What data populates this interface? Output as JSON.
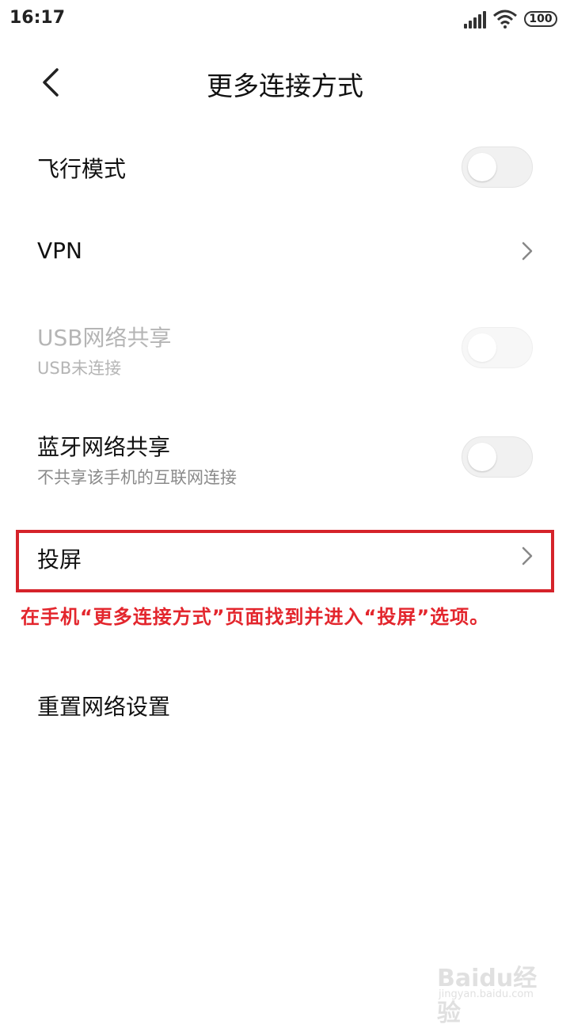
{
  "status_bar": {
    "time": "16:17",
    "battery": "100"
  },
  "header": {
    "title": "更多连接方式"
  },
  "items": [
    {
      "label": "飞行模式",
      "control": "toggle",
      "state": "off",
      "enabled": true
    },
    {
      "label": "VPN",
      "control": "chevron"
    },
    {
      "label": "USB网络共享",
      "sublabel": "USB未连接",
      "control": "toggle",
      "state": "off",
      "enabled": false
    },
    {
      "label": "蓝牙网络共享",
      "sublabel": "不共享该手机的互联网连接",
      "control": "toggle",
      "state": "off",
      "enabled": true
    },
    {
      "label": "投屏",
      "control": "chevron"
    },
    {
      "label": "重置网络设置"
    }
  ],
  "annotation": {
    "text": "在手机“更多连接方式”页面找到并进入“投屏”选项。",
    "color": "#e3262d"
  },
  "watermark": {
    "main": "Baidu经验",
    "sub": "jingyan.baidu.com"
  },
  "icons": {
    "back": "back-arrow-icon",
    "chevron": "chevron-right-icon",
    "signal": "signal-icon",
    "wifi": "wifi-icon",
    "battery": "battery-icon"
  }
}
